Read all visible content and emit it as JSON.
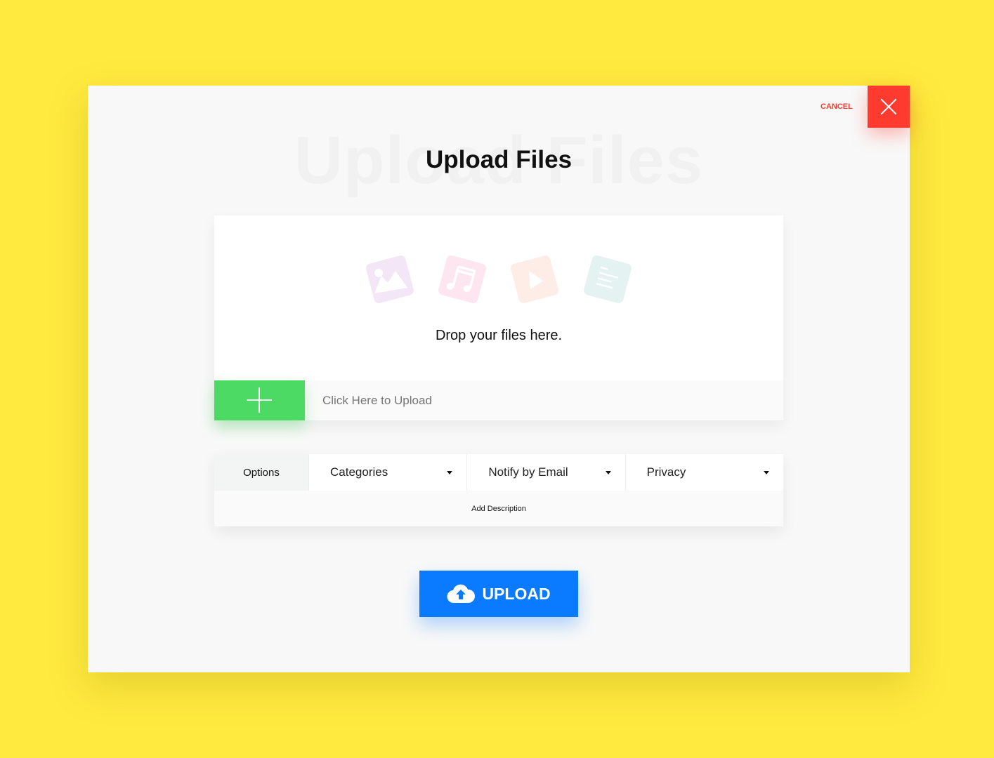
{
  "modal": {
    "title": "Upload Files",
    "cancel_label": "CANCEL",
    "close_icon": "close-icon"
  },
  "dropzone": {
    "icons": [
      "image-icon",
      "music-icon",
      "video-play-icon",
      "document-icon"
    ],
    "text": "Drop your files here.",
    "upload_placeholder": "Click Here to Upload",
    "add_icon": "plus-icon"
  },
  "options": {
    "label": "Options",
    "selects": [
      {
        "label": "Categories"
      },
      {
        "label": "Notify by Email"
      },
      {
        "label": "Privacy"
      }
    ],
    "description_label": "Add Description"
  },
  "upload_button": {
    "label": "UPLOAD",
    "icon": "cloud-upload-icon"
  },
  "colors": {
    "background": "#ffea3f",
    "close": "#ff3b30",
    "add": "#4cd964",
    "upload": "#0a7bff",
    "cancel_text": "#f23c2f"
  }
}
